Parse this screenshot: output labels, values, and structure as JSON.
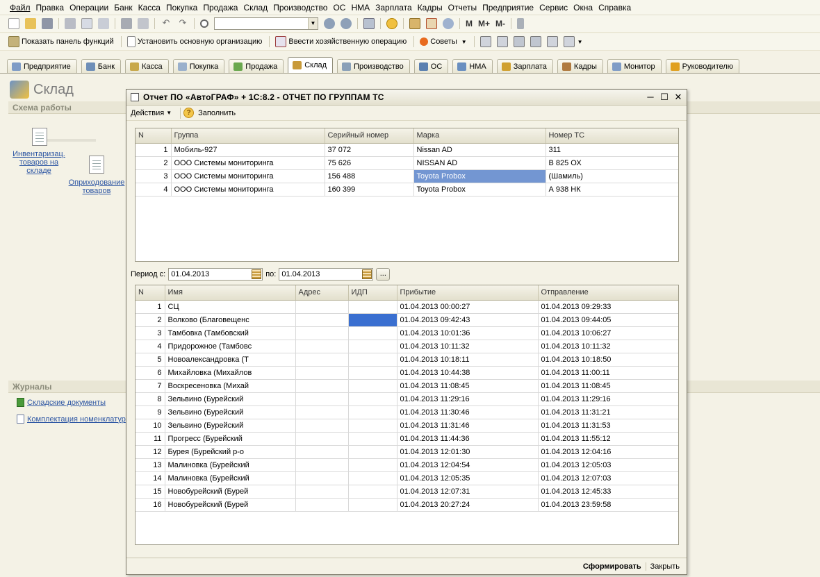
{
  "menu": [
    "Файл",
    "Правка",
    "Операции",
    "Банк",
    "Касса",
    "Покупка",
    "Продажа",
    "Склад",
    "Производство",
    "ОС",
    "НМА",
    "Зарплата",
    "Кадры",
    "Отчеты",
    "Предприятие",
    "Сервис",
    "Окна",
    "Справка"
  ],
  "toolbar2": {
    "mplus": [
      "M",
      "M+",
      "M-"
    ]
  },
  "toolbar3": {
    "show_panel": "Показать панель функций",
    "set_org": "Установить основную организацию",
    "enter_op": "Ввести хозяйственную операцию",
    "advice": "Советы"
  },
  "tabs": [
    {
      "label": "Предприятие",
      "active": false
    },
    {
      "label": "Банк",
      "active": false
    },
    {
      "label": "Касса",
      "active": false
    },
    {
      "label": "Покупка",
      "active": false
    },
    {
      "label": "Продажа",
      "active": false
    },
    {
      "label": "Склад",
      "active": true
    },
    {
      "label": "Производство",
      "active": false
    },
    {
      "label": "ОС",
      "active": false
    },
    {
      "label": "НМА",
      "active": false
    },
    {
      "label": "Зарплата",
      "active": false
    },
    {
      "label": "Кадры",
      "active": false
    },
    {
      "label": "Монитор",
      "active": false
    },
    {
      "label": "Руководителю",
      "active": false
    }
  ],
  "left": {
    "title": "Склад",
    "scheme_header": "Схема работы",
    "inventory_link": "Инвентаризац. товаров на складе",
    "receipt_link": "Оприходование товаров",
    "journals_header": "Журналы",
    "journals": [
      "Складские документы",
      "Комплектация номенклатур"
    ]
  },
  "window": {
    "title": "Отчет  ПО «АвтоГРАФ» + 1С:8.2 - ОТЧЕТ ПО ГРУППАМ ТС",
    "actions_label": "Действия",
    "fill_label": "Заполнить",
    "top_grid": {
      "headers": [
        "N",
        "Группа",
        "Серийный номер",
        "Марка",
        "Номер ТС"
      ],
      "rows": [
        [
          "1",
          "Мобиль-927",
          "37 072",
          "Nissan AD",
          "311"
        ],
        [
          "2",
          "ООО Системы мониторинга",
          "75 626",
          "NISSAN AD",
          "В 825 ОХ"
        ],
        [
          "3",
          "ООО Системы мониторинга",
          "156 488",
          "Toyota Probox",
          "(Шамиль)"
        ],
        [
          "4",
          "ООО Системы мониторинга",
          "160 399",
          "Toyota Probox",
          "А 938 НК"
        ]
      ],
      "selected": {
        "row": 2,
        "col": 3
      }
    },
    "period": {
      "from_label": "Период с:",
      "from_value": "01.04.2013",
      "to_label": "по:",
      "to_value": "01.04.2013",
      "more": "..."
    },
    "bottom_grid": {
      "headers": [
        "N",
        "Имя",
        "Адрес",
        "ИДП",
        "Прибытие",
        "Отправление"
      ],
      "rows": [
        [
          "1",
          "СЦ",
          "",
          "",
          "01.04.2013 00:00:27",
          "01.04.2013 09:29:33"
        ],
        [
          "2",
          "Волково (Благовещенс",
          "",
          "",
          "01.04.2013 09:42:43",
          "01.04.2013 09:44:05"
        ],
        [
          "3",
          "Тамбовка (Тамбовский",
          "",
          "",
          "01.04.2013 10:01:36",
          "01.04.2013 10:06:27"
        ],
        [
          "4",
          "Придорожное (Тамбовс",
          "",
          "",
          "01.04.2013 10:11:32",
          "01.04.2013 10:11:32"
        ],
        [
          "5",
          "Новоалександровка (Т",
          "",
          "",
          "01.04.2013 10:18:11",
          "01.04.2013 10:18:50"
        ],
        [
          "6",
          "Михайловка (Михайлов",
          "",
          "",
          "01.04.2013 10:44:38",
          "01.04.2013 11:00:11"
        ],
        [
          "7",
          "Воскресеновка (Михай",
          "",
          "",
          "01.04.2013 11:08:45",
          "01.04.2013 11:08:45"
        ],
        [
          "8",
          "Зельвино (Бурейский",
          "",
          "",
          "01.04.2013 11:29:16",
          "01.04.2013 11:29:16"
        ],
        [
          "9",
          "Зельвино (Бурейский",
          "",
          "",
          "01.04.2013 11:30:46",
          "01.04.2013 11:31:21"
        ],
        [
          "10",
          "Зельвино (Бурейский",
          "",
          "",
          "01.04.2013 11:31:46",
          "01.04.2013 11:31:53"
        ],
        [
          "11",
          "Прогресс (Бурейский",
          "",
          "",
          "01.04.2013 11:44:36",
          "01.04.2013 11:55:12"
        ],
        [
          "12",
          "Бурея (Бурейский р-о",
          "",
          "",
          "01.04.2013 12:01:30",
          "01.04.2013 12:04:16"
        ],
        [
          "13",
          "Малиновка (Бурейский",
          "",
          "",
          "01.04.2013 12:04:54",
          "01.04.2013 12:05:03"
        ],
        [
          "14",
          "Малиновка (Бурейский",
          "",
          "",
          "01.04.2013 12:05:35",
          "01.04.2013 12:07:03"
        ],
        [
          "15",
          "Новобурейский (Бурей",
          "",
          "",
          "01.04.2013 12:07:31",
          "01.04.2013 12:45:33"
        ],
        [
          "16",
          "Новобурейский (Бурей",
          "",
          "",
          "01.04.2013 20:27:24",
          "01.04.2013 23:59:58"
        ]
      ],
      "selected": {
        "row": 1,
        "col": 3
      }
    },
    "generate_label": "Сформировать",
    "close_label": "Закрыть"
  }
}
